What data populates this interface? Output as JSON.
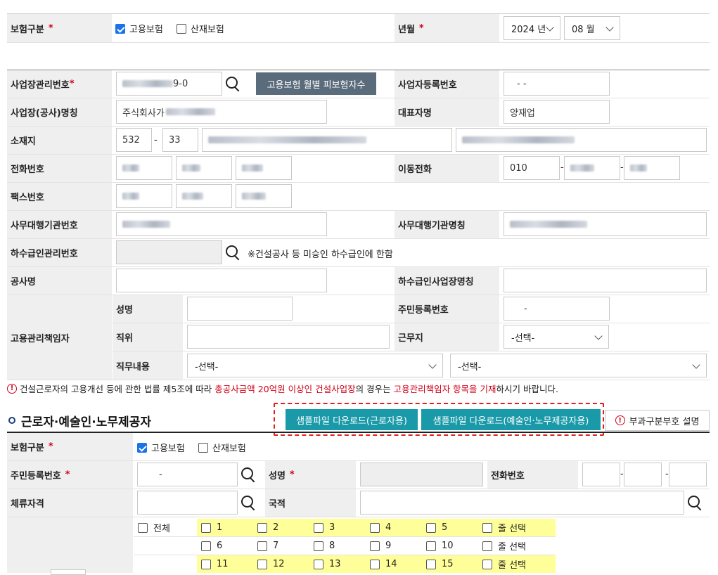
{
  "top": {
    "insurance_type_label": "보험구분",
    "employment_ins": "고용보험",
    "industrial_ins": "산재보험",
    "ym_label": "년월",
    "year": "2024 년",
    "month": "08 월"
  },
  "workplace": {
    "mgmt_no_label": "사업장관리번호",
    "mgmt_no_suffix": "9-0",
    "monthly_btn": "고용보험 월별 피보험자수",
    "biz_reg_label": "사업자등록번호",
    "biz_reg_value": "-  -",
    "name_label": "사업장(공사)명칭",
    "name_value": "주식회사가",
    "rep_label": "대표자명",
    "rep_value": "양재업",
    "addr_label": "소재지",
    "zip1": "532",
    "zip_sep": "-",
    "zip2": "33",
    "phone_label": "전화번호",
    "mobile_label": "이동전화",
    "mobile1": "010",
    "dash": "-",
    "fax_label": "팩스번호",
    "agency_no_label": "사무대행기관번호",
    "agency_name_label": "사무대행기관명칭",
    "sub_mgmt_label": "하수급인관리번호",
    "sub_mgmt_note": "※건설공사 등 미승인 하수급인에 한함",
    "construction_label": "공사명",
    "sub_name_label": "하수급인사업장명칭",
    "manager_label": "고용관리책임자",
    "mgr_name_label": "성명",
    "mgr_rrn_label": "주민등록번호",
    "mgr_rrn_value": "-",
    "mgr_pos_label": "직위",
    "mgr_work_label": "근무지",
    "mgr_work_value": "-선택-",
    "mgr_duty_label": "직무내용",
    "mgr_duty_value1": "-선택-",
    "mgr_duty_value2": "-선택-"
  },
  "notice": {
    "part1": "건설근로자의 고용개선 등에 관한 법률 제5조에 따라 ",
    "part2": "총공사금액 20억원 이상인 건설사업장",
    "part3": "의 경우는 ",
    "part4": "고용관리책임자 항목을 기재",
    "part5": "하시기 바랍니다."
  },
  "workers": {
    "section_title": "근로자·예술인·노무제공자",
    "sample_btn1": "샘플파일 다운로드(근로자용)",
    "sample_btn2": "샘플파일 다운로드(예술인·노무제공자용)",
    "code_help": "부과구분부호 설명",
    "ins_label": "보험구분",
    "employment_ins": "고용보험",
    "industrial_ins": "산재보험",
    "rrn_label": "주민등록번호",
    "rrn_value": "-",
    "name_label": "성명",
    "phone_label": "전화번호",
    "stay_label": "체류자격",
    "nation_label": "국적",
    "all": "전체",
    "row_select": "줄 선택",
    "months": [
      "1",
      "2",
      "3",
      "4",
      "5",
      "6",
      "7",
      "8",
      "9",
      "10",
      "11",
      "12",
      "13",
      "14",
      "15"
    ]
  },
  "colors": {
    "label_bg": "#efefef",
    "primary_btn": "#5a6b7b",
    "teal_btn": "#1a9aa8",
    "required": "#d0021b",
    "highlight": "#ffff99"
  }
}
